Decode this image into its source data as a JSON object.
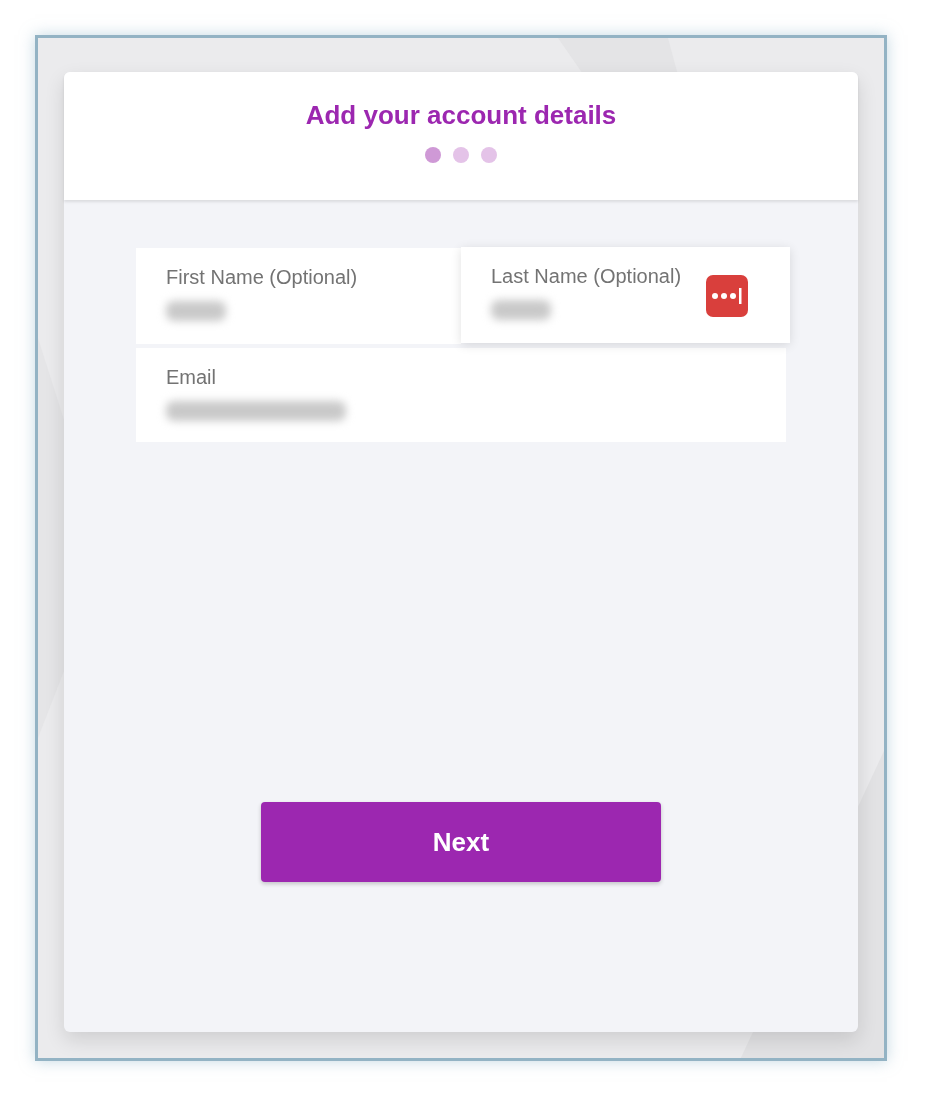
{
  "header": {
    "title": "Add your account details",
    "steps": [
      {
        "selected": true
      },
      {
        "selected": false
      },
      {
        "selected": false
      }
    ]
  },
  "fields": [
    {
      "label": "First Name (Optional)",
      "value_hidden": true,
      "focused": false,
      "autofill_icon": false
    },
    {
      "label": "Last Name (Optional)",
      "value_hidden": true,
      "focused": true,
      "autofill_icon": true
    },
    {
      "label": "Email",
      "value_hidden": true,
      "focused": false,
      "autofill_icon": false
    }
  ],
  "next_button": {
    "label": "Next"
  }
}
